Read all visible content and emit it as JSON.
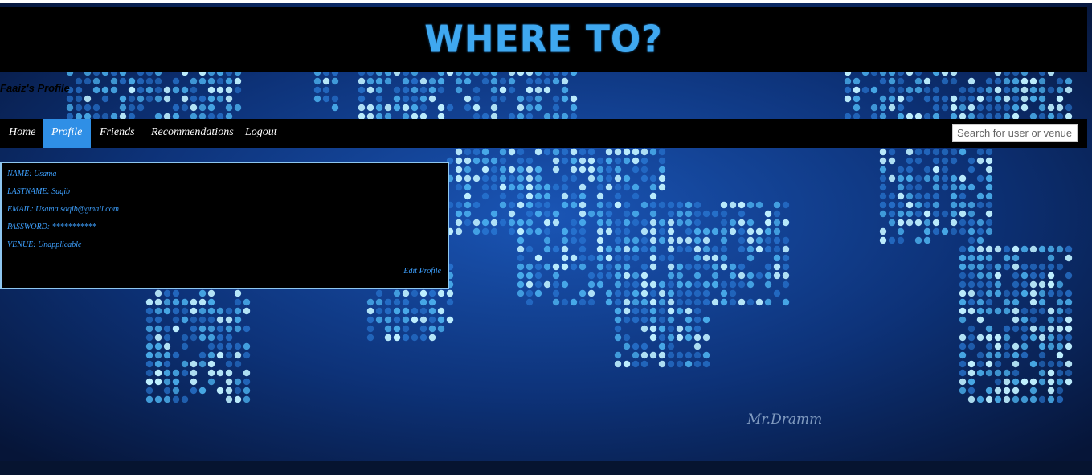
{
  "header": {
    "logo_text": "WHERE TO?"
  },
  "page": {
    "profile_title": "Faaiz's Profile"
  },
  "nav": {
    "items": [
      "Home",
      "Profile",
      "Friends",
      "Recommendations",
      "Logout"
    ],
    "active": "Profile",
    "search_placeholder": "Search for user or venue..."
  },
  "profile": {
    "name_label": "NAME:",
    "name": "Usama",
    "lastname_label": "LASTNAME:",
    "lastname": "Saqib",
    "email_label": "EMAIL:",
    "email": "Usama.saqib@gmail.com",
    "password_label": "PASSWORD:",
    "password": "***********",
    "venue_label": "VENUE:",
    "venue": "Unapplicable",
    "edit_label": "Edit Profile"
  },
  "background": {
    "signature": "Mr.Dramm"
  },
  "colors": {
    "accent": "#2f8fe6",
    "link": "#3ea1ff",
    "logo": "#3fa8f0",
    "bar": "#000000"
  }
}
